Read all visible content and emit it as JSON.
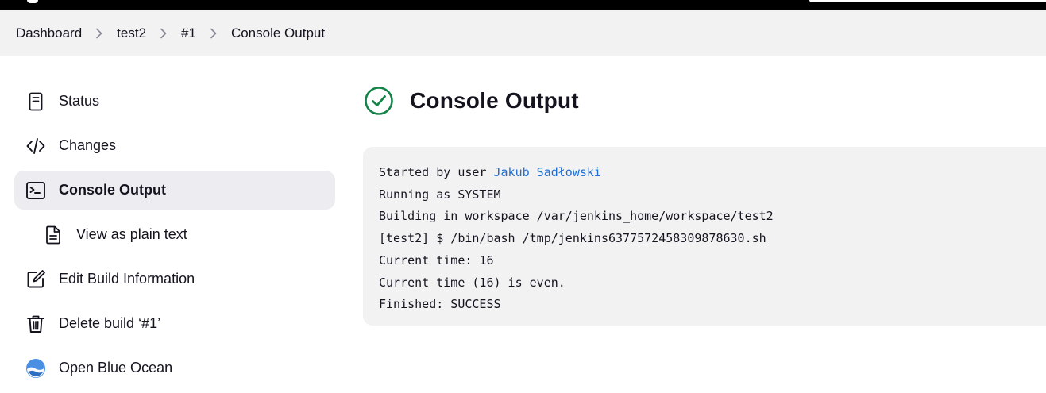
{
  "breadcrumb": {
    "items": [
      "Dashboard",
      "test2",
      "#1",
      "Console Output"
    ]
  },
  "sidebar": {
    "items": [
      {
        "label": "Status",
        "icon": "document-icon"
      },
      {
        "label": "Changes",
        "icon": "code-icon"
      },
      {
        "label": "Console Output",
        "icon": "terminal-icon",
        "active": true
      },
      {
        "label": "View as plain text",
        "icon": "file-text-icon",
        "sub": true
      },
      {
        "label": "Edit Build Information",
        "icon": "edit-icon"
      },
      {
        "label": "Delete build ‘#1’",
        "icon": "trash-icon"
      },
      {
        "label": "Open Blue Ocean",
        "icon": "blue-ocean-icon"
      }
    ]
  },
  "main": {
    "title": "Console Output",
    "status": "success",
    "console": {
      "started_prefix": "Started by user ",
      "user": "Jakub Sadłowski",
      "lines": [
        "Running as SYSTEM",
        "Building in workspace /var/jenkins_home/workspace/test2",
        "[test2] $ /bin/bash /tmp/jenkins6377572458309878630.sh",
        "Current time: 16",
        "Current time (16) is even.",
        "Finished: SUCCESS"
      ]
    }
  },
  "colors": {
    "success": "#138347",
    "link": "#1f6fd1",
    "topbar": "#000000",
    "breadcrumb_bg": "#f2f2f3",
    "active_item_bg": "#ececf1",
    "blue_ocean": "#4a90e2"
  }
}
